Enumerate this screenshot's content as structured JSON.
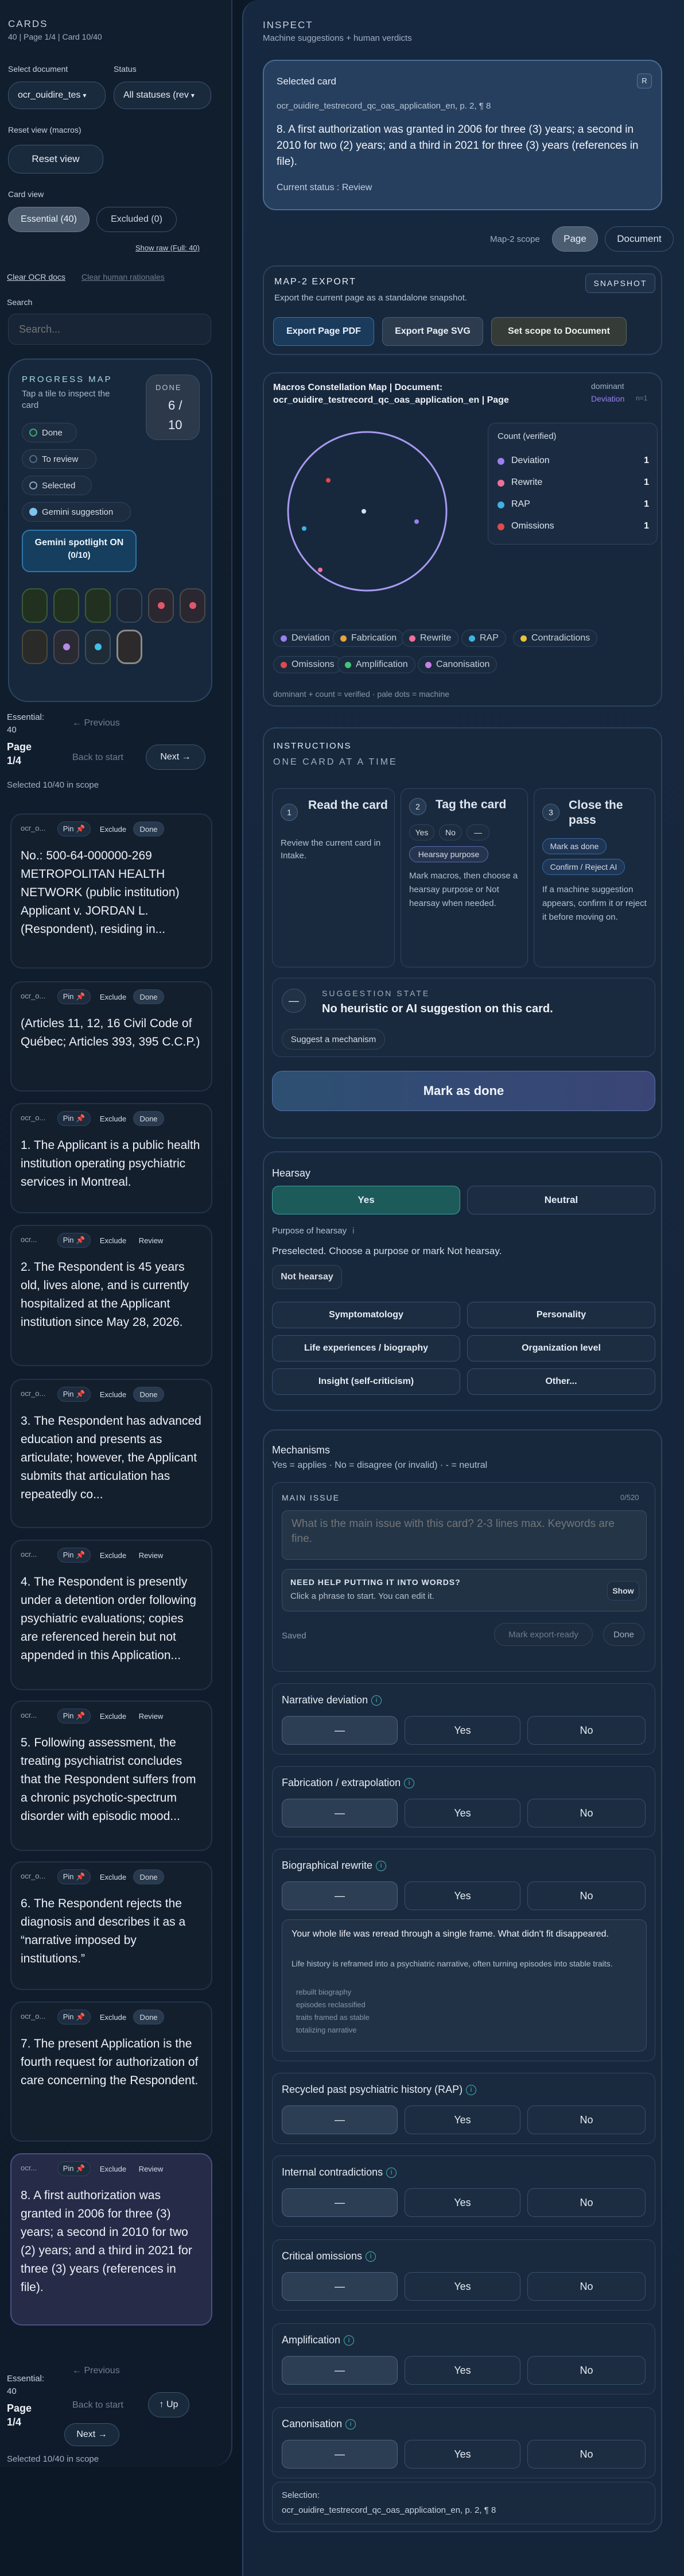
{
  "left": {
    "title": "CARDS",
    "subtitle": "40 | Page 1/4 | Card 10/40",
    "select_document_label": "Select document",
    "status_label": "Status",
    "document_value": "ocr_ouidire_tes",
    "status_value": "All statuses (rev",
    "reset_macros_label": "Reset view (macros)",
    "reset_view": "Reset view",
    "card_view_label": "Card view",
    "essential_tab": "Essential (40)",
    "excluded_tab": "Excluded (0)",
    "show_raw": "Show raw (Full: 40)",
    "clear_ocr": "Clear OCR docs",
    "clear_human": "Clear human rationales",
    "search_label": "Search",
    "search_placeholder": "Search...",
    "progress": {
      "title": "PROGRESS MAP",
      "subtitle": "Tap a tile to inspect the card",
      "done_label": "DONE",
      "done_value": "6 /",
      "done_total": "10",
      "legend": [
        "Done",
        "To review",
        "Selected",
        "Gemini suggestion"
      ],
      "spotlight": "Gemini spotlight ON",
      "spotlight_count": "(0/10)"
    },
    "nav_top": {
      "essential": "Essential:",
      "count": "40",
      "page": "Page",
      "page_value": "1/4",
      "previous": "← Previous",
      "back": "Back to start",
      "next": "Next →",
      "selected": "Selected 10/40 in scope"
    },
    "cards": [
      {
        "id": "ocr_o...",
        "pin": "Pin 📌",
        "exclude": "Exclude",
        "status": "Done",
        "text": "No.: 500-64-000000-269 METROPOLITAN HEALTH NETWORK (public institution) Applicant v. JORDAN L. (Respondent), residing in..."
      },
      {
        "id": "ocr_o...",
        "pin": "Pin 📌",
        "exclude": "Exclude",
        "status": "Done",
        "text": "(Articles 11, 12, 16 Civil Code of Québec; Articles 393, 395 C.C.P.)"
      },
      {
        "id": "ocr_o...",
        "pin": "Pin 📌",
        "exclude": "Exclude",
        "status": "Done",
        "text": "1. The Applicant is a public health institution operating psychiatric services in Montreal."
      },
      {
        "id": "ocr...",
        "pin": "Pin 📌",
        "exclude": "Exclude",
        "status": "Review",
        "text": "2. The Respondent is 45 years old, lives alone, and is currently hospitalized at the Applicant institution since May 28, 2026."
      },
      {
        "id": "ocr_o...",
        "pin": "Pin 📌",
        "exclude": "Exclude",
        "status": "Done",
        "text": "3. The Respondent has advanced education and presents as articulate; however, the Applicant submits that articulation has repeatedly co..."
      },
      {
        "id": "ocr...",
        "pin": "Pin 📌",
        "exclude": "Exclude",
        "status": "Review",
        "text": "4. The Respondent is presently under a detention order following psychiatric evaluations; copies are referenced herein but not appended in this Application..."
      },
      {
        "id": "ocr...",
        "pin": "Pin 📌",
        "exclude": "Exclude",
        "status": "Review",
        "text": "5. Following assessment, the treating psychiatrist concludes that the Respondent suffers from a chronic psychotic-spectrum disorder with episodic mood..."
      },
      {
        "id": "ocr_o...",
        "pin": "Pin 📌",
        "exclude": "Exclude",
        "status": "Done",
        "text": "6. The Respondent rejects the diagnosis and describes it as a “narrative imposed by institutions.”"
      },
      {
        "id": "ocr_o...",
        "pin": "Pin 📌",
        "exclude": "Exclude",
        "status": "Done",
        "text": "7. The present Application is the fourth request for authorization of care concerning the Respondent."
      },
      {
        "id": "ocr...",
        "pin": "Pin 📌",
        "exclude": "Exclude",
        "status": "Review",
        "text": "8. A first authorization was granted in 2006 for three (3) years; a second in 2010 for two (2) years; and a third in 2021 for three (3) years (references in file)."
      }
    ],
    "nav_bottom": {
      "essential": "Essential:",
      "count": "40",
      "page": "Page",
      "page_value": "1/4",
      "previous": "← Previous",
      "back": "Back to start",
      "up": "↑ Up",
      "next": "Next →",
      "selected": "Selected 10/40 in scope"
    }
  },
  "right": {
    "title": "INSPECT",
    "subtitle": "Machine suggestions + human verdicts",
    "selected": {
      "label": "Selected card",
      "badge": "R",
      "source": "ocr_ouidire_testrecord_qc_oas_application_en, p. 2, ¶ 8",
      "text": "8. A first authorization was granted in 2006 for three (3) years; a second in 2010 for two (2) years; and a third in 2021 for three (3) years (references in file).",
      "status": "Current status : Review"
    },
    "scope": {
      "label": "Map-2 scope",
      "page": "Page",
      "document": "Document"
    },
    "export": {
      "title": "MAP-2 EXPORT",
      "badge": "SNAPSHOT",
      "desc": "Export the current page as a standalone snapshot.",
      "pdf": "Export Page PDF",
      "svg": "Export Page SVG",
      "scope": "Set scope to Document"
    },
    "map": {
      "title": "Macros Constellation Map | Document: ocr_ouidire_testrecord_qc_oas_application_en | Page",
      "dominant": "dominant",
      "dominant_value": "Deviation",
      "dominant_n": "n=1",
      "count_title": "Count (verified)",
      "counts": [
        {
          "name": "Deviation",
          "value": "1",
          "color": "#9b7ff0"
        },
        {
          "name": "Rewrite",
          "value": "1",
          "color": "#ef6f9c"
        },
        {
          "name": "RAP",
          "value": "1",
          "color": "#3fb2e4"
        },
        {
          "name": "Omissions",
          "value": "1",
          "color": "#e04a4a"
        }
      ],
      "legend": [
        {
          "name": "Deviation",
          "color": "#9b7ff0"
        },
        {
          "name": "Fabrication",
          "color": "#e8a33e"
        },
        {
          "name": "Rewrite",
          "color": "#ef6f9c"
        },
        {
          "name": "RAP",
          "color": "#3fb2e4"
        },
        {
          "name": "Contradictions",
          "color": "#e8c23e"
        },
        {
          "name": "Omissions",
          "color": "#e04a4a"
        },
        {
          "name": "Amplification",
          "color": "#42c47a"
        },
        {
          "name": "Canonisation",
          "color": "#c77fe8"
        }
      ],
      "footnote": "dominant + count = verified · pale dots = machine"
    },
    "instructions": {
      "title": "INSTRUCTIONS",
      "sub": "ONE CARD AT A TIME",
      "steps": [
        {
          "n": "1",
          "title": "Read the card",
          "text": "Review the current card in Intake."
        },
        {
          "n": "2",
          "title": "Tag the card",
          "yes": "Yes",
          "no": "No",
          "dash": "—",
          "purpose": "Hearsay purpose",
          "text": "Mark macros, then choose a hearsay purpose or Not hearsay when needed."
        },
        {
          "n": "3",
          "title": "Close the pass",
          "done": "Mark as done",
          "confirm": "Confirm / Reject AI",
          "text": "If a machine suggestion appears, confirm it or reject it before moving on."
        }
      ],
      "suggestion_label": "SUGGESTION STATE",
      "suggestion_text": "No heuristic or AI suggestion on this card.",
      "suggest_btn": "Suggest a mechanism",
      "mark_done": "Mark as done"
    },
    "hearsay": {
      "title": "Hearsay",
      "yes": "Yes",
      "neutral": "Neutral",
      "purpose_label": "Purpose of hearsay",
      "preselected": "Preselected. Choose a purpose or mark Not hearsay.",
      "not_hearsay": "Not hearsay",
      "options": [
        "Symptomatology",
        "Personality",
        "Life experiences / biography",
        "Organization level",
        "Insight (self-criticism)",
        "Other..."
      ]
    },
    "mechanisms": {
      "title": "Mechanisms",
      "legend": "Yes = applies · No = disagree (or invalid) · - = neutral",
      "main_issue": "MAIN ISSUE",
      "main_count": "0/520",
      "main_placeholder": "What is the main issue with this card? 2-3 lines max. Keywords are fine.",
      "help_title": "NEED HELP PUTTING IT INTO WORDS?",
      "help_sub": "Click a phrase to start. You can edit it.",
      "show": "Show",
      "saved": "Saved",
      "export_ready": "Mark export-ready",
      "done": "Done",
      "items": [
        {
          "name": "Narrative deviation"
        },
        {
          "name": "Fabrication / extrapolation"
        },
        {
          "name": "Biographical rewrite"
        },
        {
          "name": "Recycled past psychiatric history (RAP)"
        },
        {
          "name": "Internal contradictions"
        },
        {
          "name": "Critical omissions"
        },
        {
          "name": "Amplification"
        },
        {
          "name": "Canonisation"
        }
      ],
      "opt_dash": "—",
      "opt_yes": "Yes",
      "opt_no": "No",
      "bio_note_title": "Your whole life was reread through a single frame. What didn't fit disappeared.",
      "bio_note_text": "Life history is reframed into a psychiatric narrative, often turning episodes into stable traits.",
      "bio_examples": [
        "rebuilt biography",
        "episodes reclassified",
        "traits framed as stable",
        "totalizing narrative"
      ]
    },
    "selection": {
      "label": "Selection:",
      "value": "ocr_ouidire_testrecord_qc_oas_application_en, p. 2, ¶ 8"
    }
  }
}
